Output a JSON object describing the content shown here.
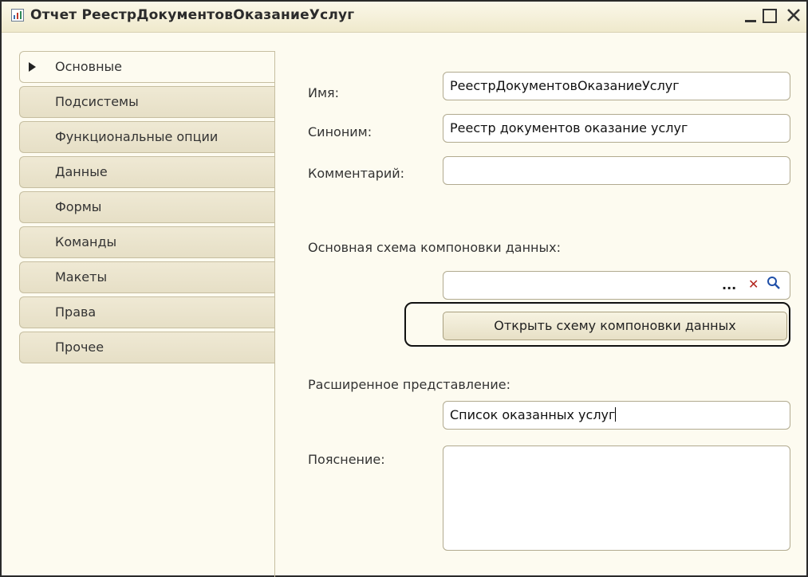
{
  "window": {
    "title": "Отчет РеестрДокументовОказаниеУслуг"
  },
  "tabs": [
    {
      "label": "Основные",
      "active": true
    },
    {
      "label": "Подсистемы",
      "active": false
    },
    {
      "label": "Функциональные опции",
      "active": false
    },
    {
      "label": "Данные",
      "active": false
    },
    {
      "label": "Формы",
      "active": false
    },
    {
      "label": "Команды",
      "active": false
    },
    {
      "label": "Макеты",
      "active": false
    },
    {
      "label": "Права",
      "active": false
    },
    {
      "label": "Прочее",
      "active": false
    }
  ],
  "form": {
    "name_label": "Имя:",
    "name_value": "РеестрДокументовОказаниеУслуг",
    "synonym_label": "Синоним:",
    "synonym_value": "Реестр документов оказание услуг",
    "comment_label": "Комментарий:",
    "comment_value": "",
    "schema_label": "Основная схема компоновки данных:",
    "schema_value": "",
    "schema_choose": "...",
    "open_schema_button": "Открыть схему компоновки данных",
    "extended_label": "Расширенное представление:",
    "extended_value": "Список оказанных услуг",
    "explanation_label": "Пояснение:",
    "explanation_value": ""
  },
  "colors": {
    "window_bg": "#fdfbf0",
    "tab_bg": "#e6dfc6",
    "close_x": "#b3261e",
    "search_icon": "#1f4fa8"
  },
  "icons": [
    "report-icon",
    "minimize-icon",
    "maximize-icon",
    "close-icon",
    "tab-arrow-icon",
    "clear-icon",
    "search-icon"
  ]
}
